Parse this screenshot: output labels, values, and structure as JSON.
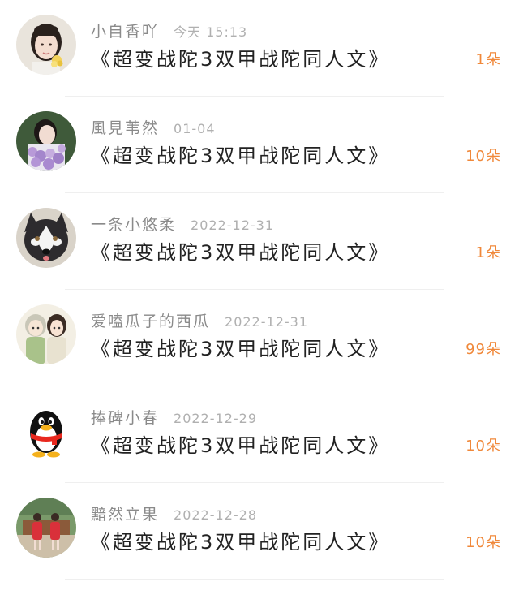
{
  "gift_list": {
    "items": [
      {
        "username": "小自香吖",
        "time": "今天 15:13",
        "title": "《超变战陀3双甲战陀同人文》",
        "flowers": "1朵",
        "avatar_icon": "avatar-girl-flower-icon"
      },
      {
        "username": "風見苇然",
        "time": "01-04",
        "title": "《超变战陀3双甲战陀同人文》",
        "flowers": "10朵",
        "avatar_icon": "avatar-girl-lavender-icon"
      },
      {
        "username": "一条小悠柔",
        "time": "2022-12-31",
        "title": "《超变战陀3双甲战陀同人文》",
        "flowers": "1朵",
        "avatar_icon": "avatar-husky-icon"
      },
      {
        "username": "爱嗑瓜子的西瓜",
        "time": "2022-12-31",
        "title": "《超变战陀3双甲战陀同人文》",
        "flowers": "99朵",
        "avatar_icon": "avatar-anime-couple-icon"
      },
      {
        "username": "捧碑小春",
        "time": "2022-12-29",
        "title": "《超变战陀3双甲战陀同人文》",
        "flowers": "10朵",
        "avatar_icon": "avatar-qq-penguin-icon"
      },
      {
        "username": "黯然立果",
        "time": "2022-12-28",
        "title": "《超变战陀3双甲战陀同人文》",
        "flowers": "10朵",
        "avatar_icon": "avatar-two-girls-icon"
      }
    ]
  },
  "colors": {
    "flower_count": "#f0883a",
    "username": "#8a8a8a",
    "time": "#b0b0b0",
    "title": "#222222",
    "divider": "#efefef"
  }
}
